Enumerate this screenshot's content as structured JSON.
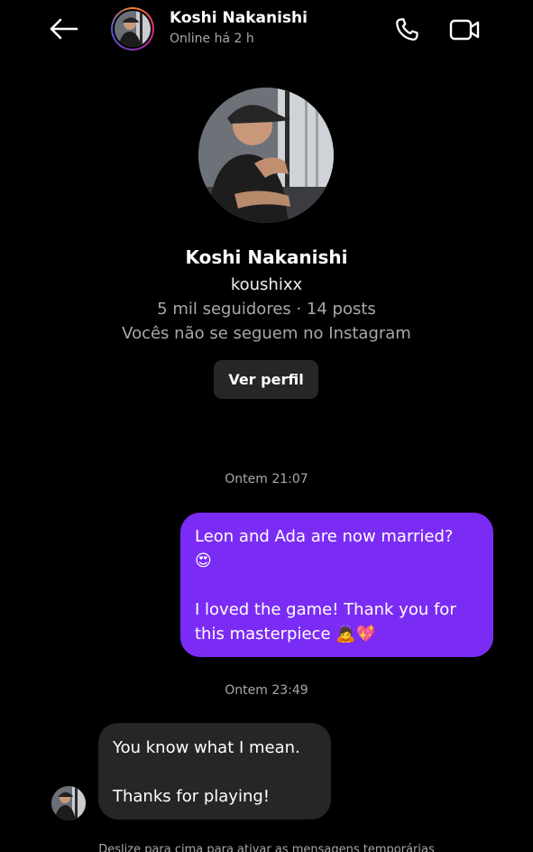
{
  "header": {
    "back_icon": "arrow-left-icon",
    "name": "Koshi Nakanishi",
    "status": "Online há 2 h",
    "call_icon": "phone-icon",
    "video_icon": "video-camera-icon",
    "story_ring_colors": [
      "#f58529",
      "#dd2a7b",
      "#8134af",
      "#515bd4"
    ]
  },
  "profile": {
    "name": "Koshi Nakanishi",
    "handle": "koushixx",
    "stats": "5 mil seguidores · 14 posts",
    "relation": "Vocês não se seguem no Instagram",
    "view_profile_label": "Ver perfil"
  },
  "messages": [
    {
      "timestamp": "Ontem 21:07",
      "direction": "outgoing",
      "lines": [
        "Leon and Ada are now married?",
        "😍",
        "",
        "I loved the game! Thank you for",
        "this masterpiece 🙇💖"
      ]
    },
    {
      "timestamp": "Ontem 23:49",
      "direction": "incoming",
      "lines": [
        "You know what I mean.",
        "",
        "Thanks for playing!"
      ]
    }
  ],
  "footer": {
    "hint": "Deslize para cima para ativar as mensagens temporárias"
  },
  "colors": {
    "background": "#000000",
    "outgoing_bubble": "#7b2cf4",
    "incoming_bubble": "#262626",
    "button_bg": "#262626",
    "secondary_text": "#a8a8a8"
  }
}
